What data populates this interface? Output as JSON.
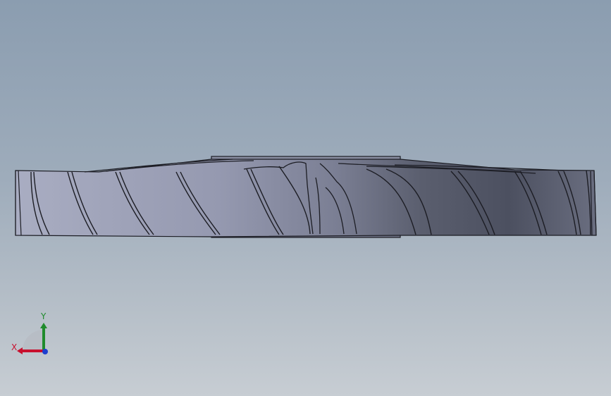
{
  "colors": {
    "background_top": "#8b9db0",
    "background_bottom": "#c7cdd3",
    "part_light": "#9a9eb4",
    "part_dark": "#4a4e5e",
    "edge": "#1c1d24",
    "axis_x": "#c8102e",
    "axis_y": "#1f8b2c",
    "axis_z": "#1d3fcf"
  },
  "triad": {
    "x_label": "X",
    "y_label": "Y"
  },
  "icons": {
    "triad": "coordinate-triad-icon"
  }
}
